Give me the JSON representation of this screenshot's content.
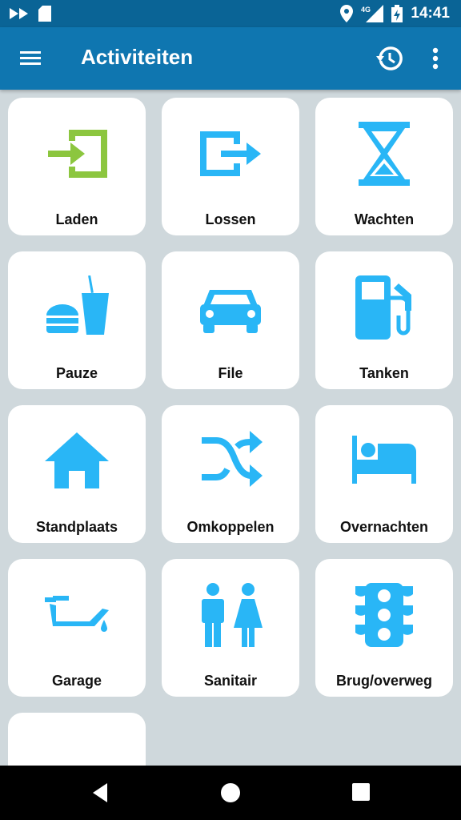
{
  "status_bar": {
    "time": "14:41",
    "network": "4G"
  },
  "app_bar": {
    "title": "Activiteiten"
  },
  "tiles": [
    {
      "label": "Laden",
      "icon": "login-icon",
      "color": "#8cc63f"
    },
    {
      "label": "Lossen",
      "icon": "logout-icon",
      "color": "#29b6f6"
    },
    {
      "label": "Wachten",
      "icon": "hourglass-icon",
      "color": "#29b6f6"
    },
    {
      "label": "Pauze",
      "icon": "fastfood-icon",
      "color": "#29b6f6"
    },
    {
      "label": "File",
      "icon": "car-icon",
      "color": "#29b6f6"
    },
    {
      "label": "Tanken",
      "icon": "gas-station-icon",
      "color": "#29b6f6"
    },
    {
      "label": "Standplaats",
      "icon": "home-icon",
      "color": "#29b6f6"
    },
    {
      "label": "Omkoppelen",
      "icon": "shuffle-icon",
      "color": "#29b6f6"
    },
    {
      "label": "Overnachten",
      "icon": "bed-icon",
      "color": "#29b6f6"
    },
    {
      "label": "Garage",
      "icon": "oil-can-icon",
      "color": "#29b6f6"
    },
    {
      "label": "Sanitair",
      "icon": "restroom-icon",
      "color": "#29b6f6"
    },
    {
      "label": "Brug/overweg",
      "icon": "traffic-light-icon",
      "color": "#29b6f6"
    },
    {
      "label": "",
      "icon": "road-icon",
      "color": "#29b6f6"
    }
  ]
}
